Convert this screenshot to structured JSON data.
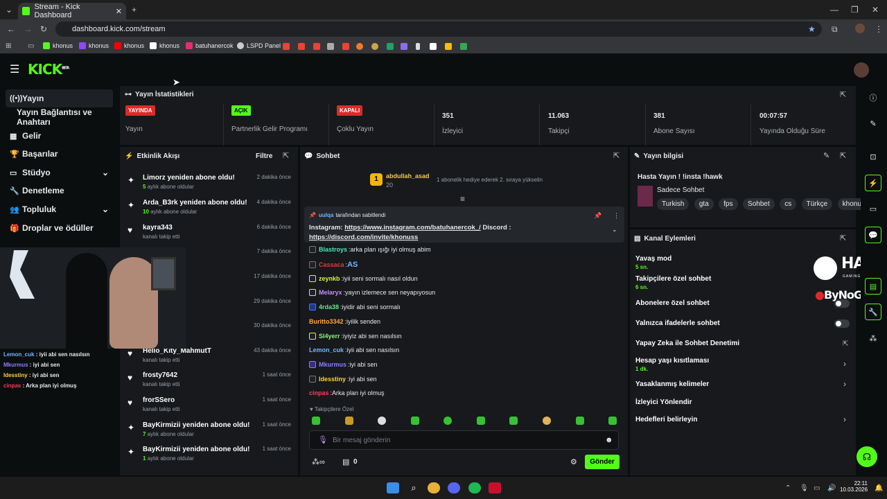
{
  "browser": {
    "tab_title": "Stream - Kick Dashboard",
    "url": "dashboard.kick.com/stream",
    "bookmarks": [
      "khonus",
      "khonus",
      "khonus",
      "khonus",
      "batuhanercok",
      "LSPD Panel"
    ]
  },
  "header": {
    "logo": "KICK",
    "logo_sup": "BETA"
  },
  "sidebar": {
    "items": [
      {
        "label": "Yayın",
        "icon": "((•))"
      },
      {
        "label": "Yayın Bağlantısı ve Anahtarı",
        "icon": ""
      },
      {
        "label": "Gelir",
        "icon": "▦"
      },
      {
        "label": "Başarılar",
        "icon": "🏆"
      },
      {
        "label": "Stüdyo",
        "icon": "▭"
      },
      {
        "label": "Denetleme",
        "icon": "🔧"
      },
      {
        "label": "Topluluk",
        "icon": "👥"
      },
      {
        "label": "Droplar ve ödüller",
        "icon": "🎁"
      }
    ]
  },
  "stats": {
    "title": "Yayın İstatistikleri",
    "items": [
      {
        "badge": "YAYINDA",
        "label": "Yayın",
        "color": "#e02828"
      },
      {
        "badge": "AÇIK",
        "label": "Partnerlik Gelir Programı",
        "color": "#53fc18"
      },
      {
        "badge": "KAPALI",
        "label": "Çoklu Yayın",
        "color": "#e02828"
      },
      {
        "value": "351",
        "label": "İzleyici"
      },
      {
        "value": "11.063",
        "label": "Takipçi"
      },
      {
        "value": "381",
        "label": "Abone Sayısı"
      },
      {
        "value": "00:07:57",
        "label": "Yayında Olduğu Süre"
      }
    ]
  },
  "activity": {
    "title": "Etkinlik Akışı",
    "filter": "Filtre",
    "items": [
      {
        "name": "Limorz yeniden abone oldu!",
        "sub_num": "5",
        "sub": "aylık abone oldular",
        "time": "2 dakika önce",
        "icon": "✦"
      },
      {
        "name": "Arda_B3rk yeniden abone oldu!",
        "sub_num": "10",
        "sub": "aylık abone oldular",
        "time": "4 dakika önce",
        "icon": "✦"
      },
      {
        "name": "kayra343",
        "sub_num": "",
        "sub": "kanalı takip etti",
        "time": "6 dakika önce",
        "icon": "♥"
      },
      {
        "name": "",
        "sub_num": "",
        "sub": "",
        "time": "7 dakika önce",
        "icon": ""
      },
      {
        "name": "",
        "sub_num": "",
        "sub": "",
        "time": "17 dakika önce",
        "icon": ""
      },
      {
        "name": "",
        "sub_num": "",
        "sub": "",
        "time": "29 dakika önce",
        "icon": ""
      },
      {
        "name": "",
        "sub_num": "",
        "sub": "",
        "time": "30 dakika önce",
        "icon": ""
      },
      {
        "name": "Hello_Kity_MahmutT",
        "sub_num": "",
        "sub": "kanalı takip etti",
        "time": "43 dakika önce",
        "icon": "♥"
      },
      {
        "name": "frosty7642",
        "sub_num": "",
        "sub": "kanalı takip etti",
        "time": "1 saat önce",
        "icon": "♥"
      },
      {
        "name": "frorSSero",
        "sub_num": "",
        "sub": "kanalı takip etti",
        "time": "1 saat önce",
        "icon": "♥"
      },
      {
        "name": "BayKirmizii yeniden abone oldu!",
        "sub_num": "7",
        "sub": "aylık abone oldular",
        "time": "1 saat önce",
        "icon": "✦"
      },
      {
        "name": "BayKirmizii yeniden abone oldu!",
        "sub_num": "1",
        "sub": "aylık abone oldular",
        "time": "1 saat önce",
        "icon": "✦"
      }
    ]
  },
  "chat": {
    "title": "Sohbet",
    "gift_user": "abdullah_asad",
    "gift_count": "20",
    "gift_rank": "1",
    "gift_text": "1 abonelik hediye ederek 2. sıraya yükselin",
    "pinned_by": "uulqa",
    "pinned_label": "tarafından sabitlendi",
    "pinned_text_1": "Instagram: ",
    "pinned_link_1": "https://www.instagram.com/batuhanercok_/",
    "pinned_text_2": " Discord :",
    "pinned_link_2": "https://discord.com/invite/khonuss",
    "messages": [
      {
        "user": "Blastroys",
        "text": "arka plan ışığı iyi olmuş abim",
        "color": "#4ee6b0"
      },
      {
        "user": "Cassaca",
        "text": "AS",
        "color": "#e03a3a"
      },
      {
        "user": "zeynkb",
        "text": "iyii seni sormalı nasıl oldun",
        "color": "#d8f53a"
      },
      {
        "user": "Melaryx",
        "text": "yayın izlemece sen neyapıyosun",
        "color": "#c98bff"
      },
      {
        "user": "4rda38",
        "text": "iyidir abi seni sormalı",
        "color": "#5ee88f"
      },
      {
        "user": "Buritto3342",
        "text": "iyilik senden",
        "color": "#ffa63a"
      },
      {
        "user": "Sl4yerr",
        "text": "iyiyiz abi sen nasılsın",
        "color": "#8ef27a"
      },
      {
        "user": "Lemon_cuk",
        "text": "iyii abi sen nasılsın",
        "color": "#6fb8ff"
      },
      {
        "user": "Mkurmus",
        "text": "iyi abi sen",
        "color": "#8a7dff"
      },
      {
        "user": "Idesstiny",
        "text": "iyi abi sen",
        "color": "#ffd23a"
      },
      {
        "user": "cinpas",
        "text": "Arka plan iyi olmuş",
        "color": "#ff3a5c"
      }
    ],
    "followers_only": "Takipçilere Özel",
    "placeholder": "Bir mesaj gönderin",
    "points": "0",
    "send": "Gönder"
  },
  "stream_info": {
    "title": "Yayın bilgisi",
    "stream_title": "Hasta Yayın ! !insta !hawk",
    "category": "Sadece Sohbet",
    "tags": [
      "Turkish",
      "gta",
      "fps",
      "Sohbet",
      "cs",
      "Türkçe",
      "khonus"
    ]
  },
  "channel_actions": {
    "title": "Kanal Eylemleri",
    "items": [
      {
        "label": "Yavaş mod",
        "sub": "5 sn."
      },
      {
        "label": "Takipçilere özel sohbet",
        "sub": "6 sn."
      },
      {
        "label": "Abonelere özel sohbet",
        "sub": ""
      },
      {
        "label": "Yalnızca ifadelerle sohbet",
        "sub": ""
      },
      {
        "label": "Yapay Zeka ile Sohbet Denetimi",
        "sub": ""
      },
      {
        "label": "Hesap yaşı kısıtlaması",
        "sub": "1 dk."
      },
      {
        "label": "Yasaklanmış kelimeler",
        "sub": ""
      },
      {
        "label": "İzleyici Yönlendir",
        "sub": ""
      },
      {
        "label": "Hedefleri belirleyin",
        "sub": ""
      }
    ]
  },
  "overlay": {
    "brand": "HAWK",
    "brand_sub": "GAMING CHAIR",
    "brand2": "ByNoGame",
    "chat": [
      {
        "user": "Lemon_cuk",
        "text": "iyii abi sen nasılsın",
        "color": "#6fb8ff"
      },
      {
        "user": "Mkurmus",
        "text": "iyi abi sen",
        "color": "#8a7dff"
      },
      {
        "user": "Idesstiny",
        "text": "iyi abi sen",
        "color": "#ffd23a"
      },
      {
        "user": "cinpas",
        "text": "Arka plan iyi olmuş",
        "color": "#ff3a5c"
      }
    ]
  },
  "taskbar": {
    "time": "22:11",
    "date": "10.03.2026"
  }
}
